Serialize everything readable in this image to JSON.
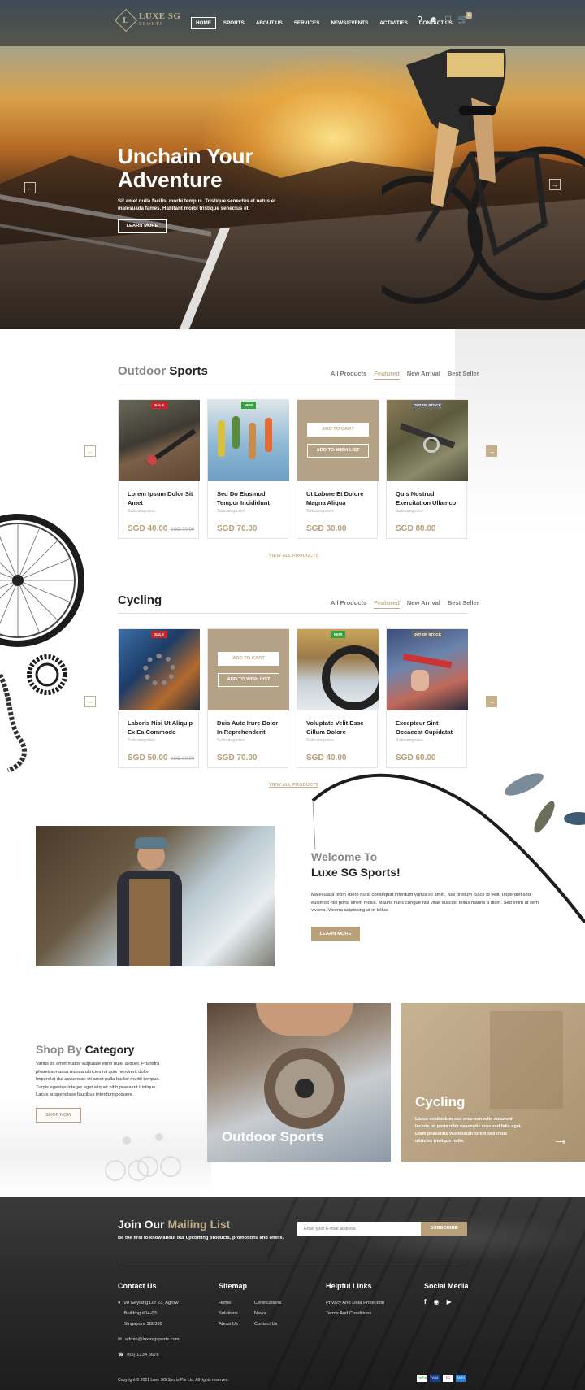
{
  "brand": {
    "name": "LUXE SG",
    "sub": "SPORTS"
  },
  "nav": [
    "HOME",
    "SPORTS",
    "ABOUT US",
    "SERVICES",
    "NEWS/EVENTS",
    "ACTIVITIES",
    "CONTACT US"
  ],
  "header": {
    "cart_count": "0"
  },
  "hero": {
    "title": "Unchain Your Adventure",
    "text": "Sit amet nulla facilisi morbi tempus. Tristique senectus et netus et malesuada fames. Habitant morbi tristique senectus et.",
    "button": "LEARN MORE"
  },
  "tabs": [
    "All Products",
    "Featured",
    "New Arrival",
    "Best Seller"
  ],
  "outdoor": {
    "title_light": "Outdoor",
    "title_bold": "Sports",
    "products": [
      {
        "name": "Lorem Ipsum Dolor Sit Amet",
        "cat": "Subcategories",
        "price": "SGD 40.00",
        "old": "SGD 70.00",
        "tag": "SALE"
      },
      {
        "name": "Sed Do Eiusmod Tempor Incididunt",
        "cat": "Subcategories",
        "price": "SGD 70.00",
        "tag": "NEW"
      },
      {
        "name": "Ut Labore Et Dolore Magna Aliqua",
        "cat": "Subcategories",
        "price": "SGD 30.00",
        "add_cart": "ADD TO CART",
        "add_wish": "ADD TO WISH LIST"
      },
      {
        "name": "Quis Nostrud Exercitation Ullamco",
        "cat": "Subcategories",
        "price": "SGD 80.00",
        "tag": "OUT OF STOCK"
      }
    ],
    "view_all": "VIEW ALL PRODUCTS"
  },
  "cycling": {
    "title": "Cycling",
    "products": [
      {
        "name": "Laboris Nisi Ut Aliquip Ex Ea Commodo",
        "cat": "Subcategories",
        "price": "SGD 50.00",
        "old": "SGD 80.00",
        "tag": "SALE"
      },
      {
        "name": "Duis Aute Irure Dolor In Reprehenderit",
        "cat": "Subcategories",
        "price": "SGD 70.00",
        "add_cart": "ADD TO CART",
        "add_wish": "ADD TO WISH LIST"
      },
      {
        "name": "Voluptate Velit Esse Cillum Dolore",
        "cat": "Subcategories",
        "price": "SGD 40.00",
        "tag": "NEW"
      },
      {
        "name": "Excepteur Sint Occaecat Cupidatat",
        "cat": "Subcategories",
        "price": "SGD 60.00",
        "tag": "OUT OF STOCK"
      }
    ],
    "view_all": "VIEW ALL PRODUCTS"
  },
  "welcome": {
    "line1": "Welcome To",
    "line2": "Luxe SG Sports!",
    "text": "Malesuada proin libero nunc consequat interdum varius sit amet. Nisl pretium fusce id velit. Imperdiet sed euismod nisi porta lorem mollis. Mauris nunc congue nisi vitae suscipit tellus mauris a diam. Sed enim ut sem viverra. Viverra adipiscing at in tellus.",
    "button": "LEARN MORE"
  },
  "category": {
    "title_light": "Shop By",
    "title_bold": "Category",
    "text": "Varius sit amet mattis vulputate enim nulla aliquet. Pharetra pharetra massa massa ultricies mi quis hendrerit dolor. Imperdiet dui accumsan sit amet nulla facilisi morbi tempus. Turpis egestas integer eget aliquet nibh praesent tristique. Lacus suspendisse faucibus interdum posuere.",
    "button": "SHOP NOW",
    "outdoor_label": "Outdoor Sports",
    "cycling_label": "Cycling",
    "cycling_text": "Lacus vestibulum sed arcu non odio euismod lacinia, at porta nibh venenatis cras sed felis eget. Diam phasellus vestibulum lorem sed risus ultricies tristique nulla."
  },
  "mailing": {
    "title_white": "Join Our",
    "title_gold": "Mailing List",
    "text": "Be the first to know about our upcoming products, promotions and offers.",
    "placeholder": "Enter your E-mail address",
    "button": "SUBSCRIBE"
  },
  "footer": {
    "contact_title": "Contact Us",
    "address": [
      "90 Geylang Lor 23, Agrow",
      "Building #04-03",
      "Singapore 388399"
    ],
    "email": "admin@luxesgsports.com",
    "phone": "(65) 1234 5678",
    "sitemap_title": "Sitemap",
    "sitemap_a": [
      "Home",
      "Solutions",
      "About Us"
    ],
    "sitemap_b": [
      "Certifications",
      "News",
      "Contact Us"
    ],
    "helpful_title": "Helpful Links",
    "helpful": [
      "Privacy And Data Protection",
      "Terms And Conditions"
    ],
    "social_title": "Social Media",
    "social_icons": [
      "facebook-icon",
      "instagram-icon",
      "youtube-icon"
    ],
    "copyright": "Copyright © 2021 Luxe SG Sports Pte Ltd. All rights reserved.",
    "payments": [
      "PayPal",
      "VISA",
      "MC",
      "AMEX"
    ]
  },
  "colors": {
    "accent": "#b7a07a",
    "accent_light": "#c4b08a",
    "sale": "#c7262b",
    "new": "#35a33b",
    "footer": "#2c2c2c"
  }
}
